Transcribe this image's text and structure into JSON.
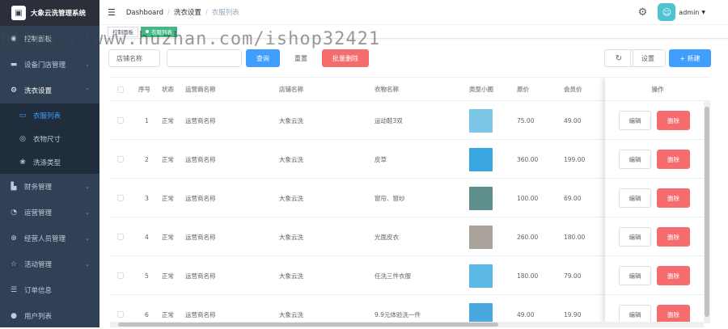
{
  "app": {
    "title": "大象云洗管理系统"
  },
  "sidebar": {
    "items": [
      {
        "label": "控制面板",
        "icon": "dashboard-icon"
      },
      {
        "label": "设备门店管理",
        "icon": "store-icon"
      },
      {
        "label": "洗衣设置",
        "icon": "settings-icon",
        "open": true,
        "children": [
          {
            "label": "衣服列表",
            "icon": "clothes-icon",
            "active": true
          },
          {
            "label": "衣物尺寸",
            "icon": "size-icon"
          },
          {
            "label": "洗涤类型",
            "icon": "wash-icon"
          }
        ]
      },
      {
        "label": "财务管理",
        "icon": "finance-icon"
      },
      {
        "label": "运营管理",
        "icon": "ops-icon"
      },
      {
        "label": "经营人员管理",
        "icon": "staff-icon"
      },
      {
        "label": "活动管理",
        "icon": "star-icon"
      },
      {
        "label": "订单信息",
        "icon": "order-icon"
      },
      {
        "label": "用户列表",
        "icon": "user-icon"
      }
    ]
  },
  "header": {
    "breadcrumb": [
      "Dashboard",
      "洗衣设置",
      "衣服列表"
    ],
    "username": "admin"
  },
  "tags": [
    {
      "label": "控制面板",
      "active": false
    },
    {
      "label": "衣服列表",
      "active": true
    }
  ],
  "toolbar": {
    "store_select": "店铺名称",
    "query": "查询",
    "reset": "重置",
    "bulk_delete": "批量删除",
    "settings": "设置",
    "add": "+ 新建"
  },
  "table": {
    "headers": [
      "序号",
      "状态",
      "运营商名称",
      "店铺名称",
      "衣物名称",
      "类型小图",
      "原价",
      "会员价"
    ],
    "op_header": "操作",
    "edit_label": "编辑",
    "delete_label": "删除",
    "rows": [
      {
        "no": "1",
        "status": "正常",
        "operator": "运营商名称",
        "store": "大象云洗",
        "name": "运动鞋3双",
        "price": "75.00",
        "member": "49.00",
        "thumb": "#7cc7e8"
      },
      {
        "no": "2",
        "status": "正常",
        "operator": "运营商名称",
        "store": "大象云洗",
        "name": "皮草",
        "price": "360.00",
        "member": "199.00",
        "thumb": "#3aa6df"
      },
      {
        "no": "3",
        "status": "正常",
        "operator": "运营商名称",
        "store": "大象云洗",
        "name": "窗帘、窗纱",
        "price": "100.00",
        "member": "69.00",
        "thumb": "#5f8f8c"
      },
      {
        "no": "4",
        "status": "正常",
        "operator": "运营商名称",
        "store": "大象云洗",
        "name": "光面皮衣",
        "price": "260.00",
        "member": "180.00",
        "thumb": "#a9a39c"
      },
      {
        "no": "5",
        "status": "正常",
        "operator": "运营商名称",
        "store": "大象云洗",
        "name": "任洗三件衣服",
        "price": "180.00",
        "member": "79.00",
        "thumb": "#5bb8e6"
      },
      {
        "no": "6",
        "status": "正常",
        "operator": "运营商名称",
        "store": "大象云洗",
        "name": "9.9元体验洗一件",
        "price": "49.00",
        "member": "19.90",
        "thumb": "#4aa8de"
      }
    ]
  },
  "watermark": "https://www.huzhan.com/ishop32421"
}
